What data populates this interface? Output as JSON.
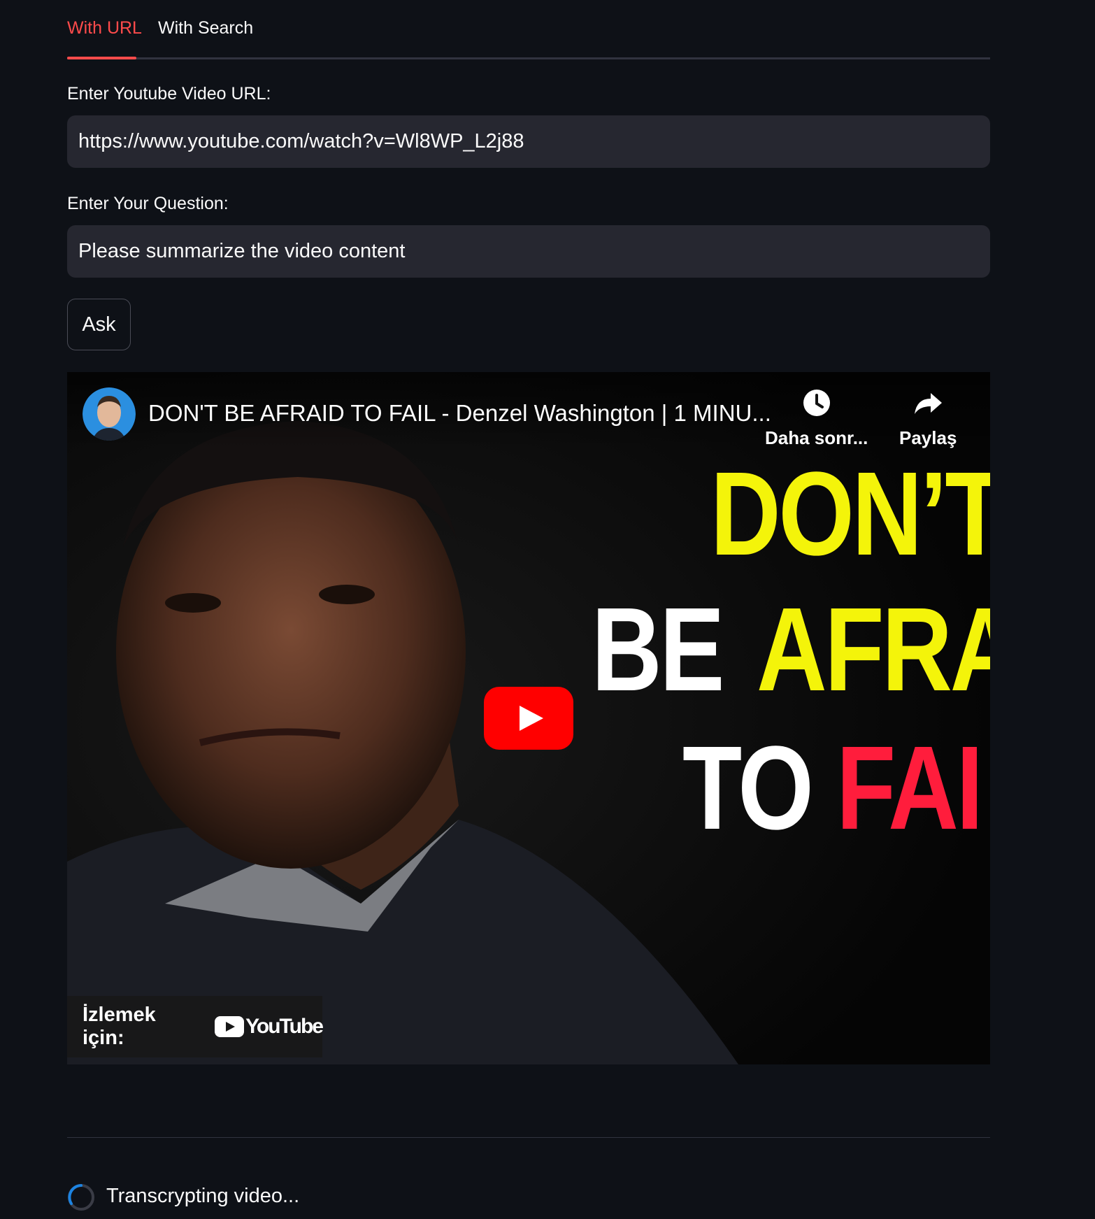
{
  "tabs": [
    {
      "label": "With URL",
      "active": true
    },
    {
      "label": "With Search",
      "active": false
    }
  ],
  "form": {
    "url_label": "Enter Youtube Video URL:",
    "url_value": "https://www.youtube.com/watch?v=Wl8WP_L2j88",
    "question_label": "Enter Your Question:",
    "question_value": "Please summarize the video content",
    "ask_label": "Ask"
  },
  "video": {
    "title": "DON'T BE AFRAID TO FAIL - Denzel Washington | 1 MINU...",
    "watch_later_label": "Daha sonr...",
    "share_label": "Paylaş",
    "poster_words": [
      "DON’T",
      "BE",
      "AFRA",
      "TO",
      "FAI"
    ],
    "watch_on_label": "İzlemek için:",
    "youtube_wordmark": "YouTube"
  },
  "status": {
    "text": "Transcrypting video..."
  },
  "colors": {
    "background": "#0e1117",
    "accent": "#ff4b4b",
    "input_bg": "#262730",
    "poster_yellow": "#f4f40a",
    "poster_red": "#ff1d3c",
    "youtube_red": "#ff0000"
  }
}
